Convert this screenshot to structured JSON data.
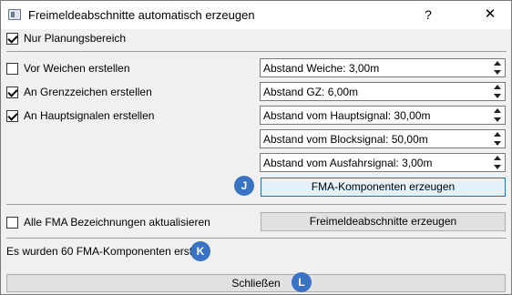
{
  "window": {
    "title": "Freimeldeabschnitte automatisch erzeugen",
    "help_glyph": "?",
    "close_glyph": "✕"
  },
  "nur_planungsbereich": {
    "label": "Nur Planungsbereich",
    "checked": true
  },
  "options": [
    {
      "label": "Vor Weichen erstellen",
      "checked": false
    },
    {
      "label": "An Grenzzeichen erstellen",
      "checked": true
    },
    {
      "label": "An Hauptsignalen erstellen",
      "checked": true
    }
  ],
  "spinboxes": [
    {
      "text": "Abstand Weiche: 3,00m"
    },
    {
      "text": "Abstand GZ: 6,00m"
    },
    {
      "text": "Abstand vom Hauptsignal: 30,00m"
    },
    {
      "text": "Abstand vom Blocksignal: 50,00m"
    },
    {
      "text": "Abstand vom Ausfahrsignal: 3,00m"
    }
  ],
  "fma_button": {
    "label": "FMA-Komponenten erzeugen"
  },
  "update_all": {
    "label": "Alle FMA Bezeichnungen aktualisieren",
    "checked": false
  },
  "freimelde_button": {
    "label": "Freimeldeabschnitte erzeugen"
  },
  "status": {
    "text": "Es wurden 60 FMA-Komponenten erstellt"
  },
  "close_button": {
    "label": "Schließen"
  },
  "badges": {
    "j": "J",
    "k": "K",
    "l": "L",
    "color": "#3b73c4"
  }
}
